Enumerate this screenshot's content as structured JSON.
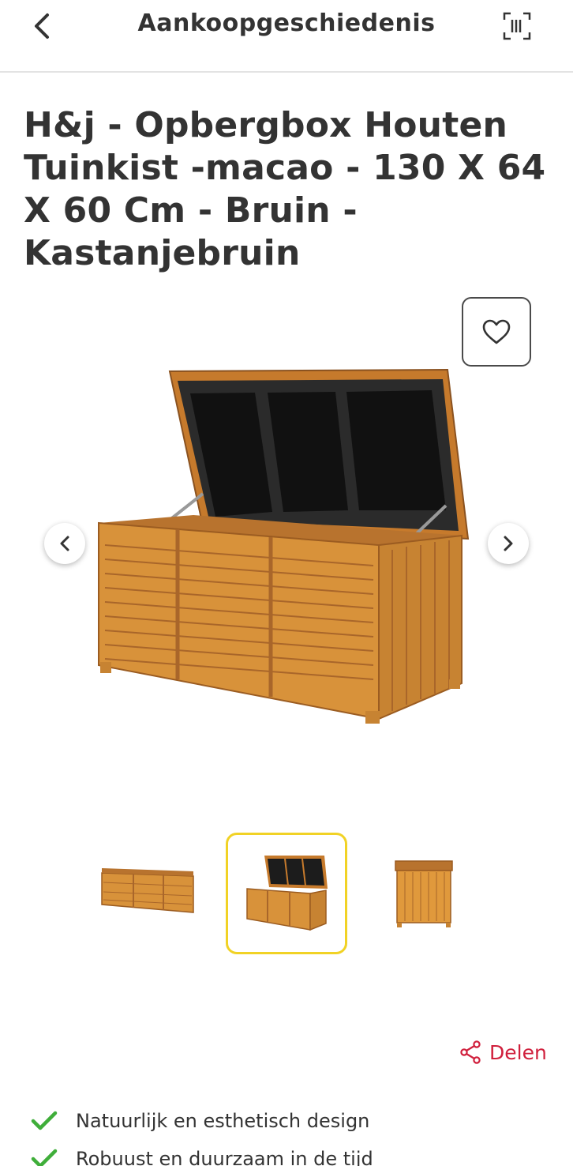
{
  "header": {
    "title": "Aankoopgeschiedenis",
    "back_icon": "chevron-left-icon",
    "scan_icon": "barcode-scan-icon"
  },
  "product": {
    "title": "H&j - Opbergbox Houten Tuinkist -macao - 130 X 64 X 60 Cm - Bruin - Kastanjebruin",
    "favorite_icon": "heart-icon"
  },
  "gallery": {
    "prev_icon": "chevron-left-icon",
    "next_icon": "chevron-right-icon",
    "thumbnails_count": 3,
    "selected_index": 1
  },
  "share": {
    "label": "Delen",
    "icon": "share-icon"
  },
  "features": [
    {
      "text": "Natuurlijk en esthetisch design"
    },
    {
      "text": "Robuust en duurzaam in de tijd"
    }
  ],
  "colors": {
    "text": "#333333",
    "accent_red": "#d01f3c",
    "selected_border": "#f1d225",
    "check_green": "#3fae3a",
    "wood": "#d8923a"
  }
}
